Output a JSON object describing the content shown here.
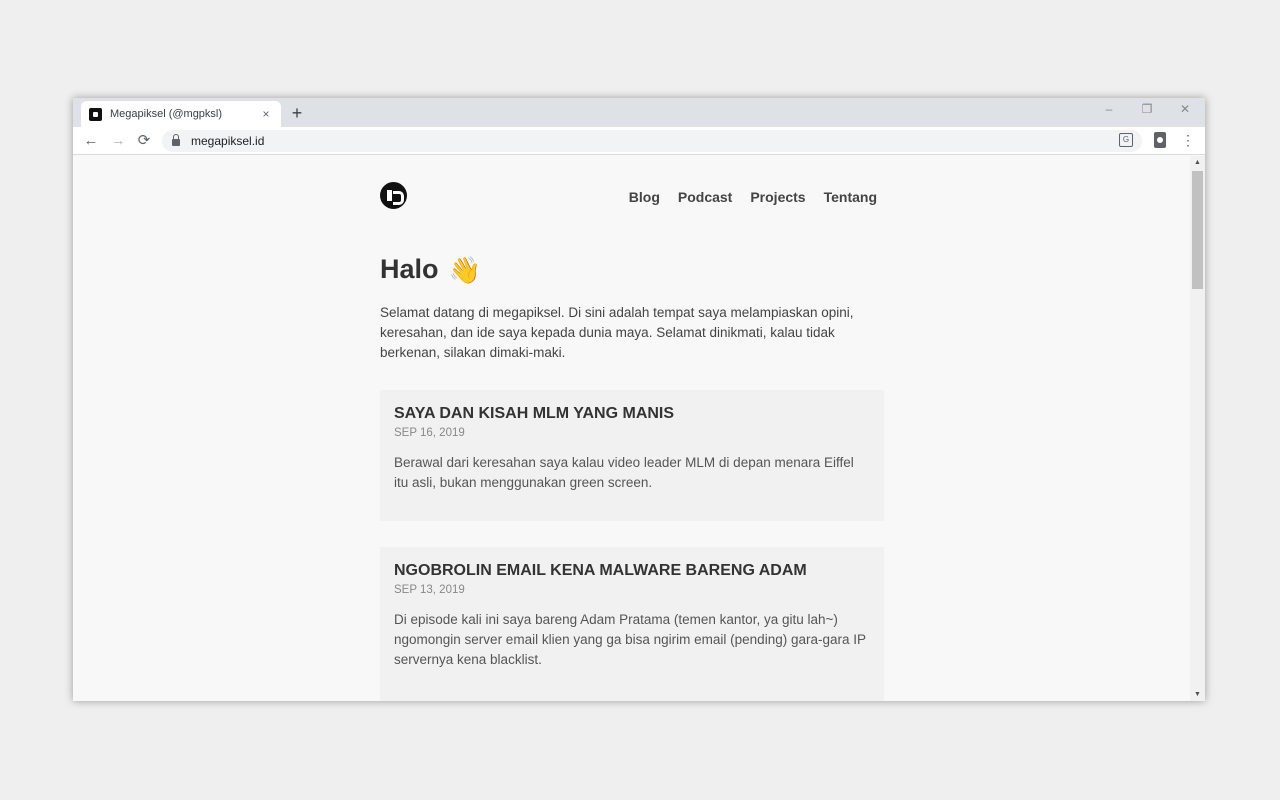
{
  "browser": {
    "tab_title": "Megapiksel (@mgpksl)",
    "tab_close": "×",
    "new_tab": "+",
    "url": "megapiksel.id",
    "back": "←",
    "forward": "→",
    "reload": "⟳",
    "translate_glyph": "G",
    "menu_glyph": "⋮",
    "minimize": "–",
    "restore": "❐",
    "close": "✕",
    "scroll_up": "▲",
    "scroll_down": "▼"
  },
  "site": {
    "nav": [
      "Blog",
      "Podcast",
      "Projects",
      "Tentang"
    ],
    "greeting": "Halo",
    "wave_emoji": "👋",
    "intro": "Selamat datang di megapiksel. Di sini adalah tempat saya melampiaskan opini, keresahan, dan ide saya kepada dunia maya. Selamat dinikmati, kalau tidak berkenan, silakan dimaki-maki."
  },
  "posts": [
    {
      "title": "SAYA DAN KISAH MLM YANG MANIS",
      "date": "SEP 16, 2019",
      "excerpt": "Berawal dari keresahan saya kalau video leader MLM di depan menara Eiffel itu asli, bukan menggunakan green screen."
    },
    {
      "title": "NGOBROLIN EMAIL KENA MALWARE BARENG ADAM",
      "date": "SEP 13, 2019",
      "excerpt": "Di episode kali ini saya bareng Adam Pratama (temen kantor, ya gitu lah~) ngomongin server email klien yang ga bisa ngirim email (pending) gara-gara IP servernya kena blacklist."
    }
  ],
  "colors": {
    "page_bg": "#f8f8f8",
    "card_bg": "#f1f1f1",
    "text": "#333333",
    "tabstrip": "#dee1e6"
  }
}
